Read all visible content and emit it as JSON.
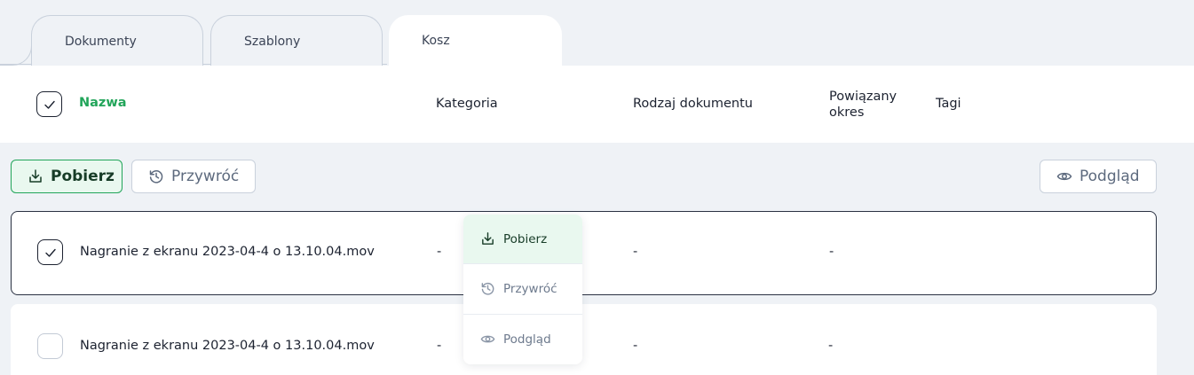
{
  "tabs": [
    {
      "label": "Dokumenty"
    },
    {
      "label": "Szablony"
    },
    {
      "label": "Kosz",
      "active": true
    }
  ],
  "table": {
    "headers": {
      "name": "Nazwa",
      "category": "Kategoria",
      "doc_type": "Rodzaj dokumentu",
      "period": "Powiązany okres",
      "tags": "Tagi"
    },
    "rows": [
      {
        "checked": true,
        "name": "Nagranie z ekranu 2023-04-4 o 13.10.04.mov",
        "category": "-",
        "doc_type": "-",
        "period": "-",
        "tags": ""
      },
      {
        "checked": false,
        "name": "Nagranie z ekranu 2023-04-4 o 13.10.04.mov",
        "category": "-",
        "doc_type": "-",
        "period": "-",
        "tags": ""
      }
    ]
  },
  "toolbar": {
    "download_label": "Pobierz",
    "restore_label": "Przywróć",
    "preview_label": "Podgląd"
  },
  "context_menu": {
    "items": [
      {
        "label": "Pobierz",
        "icon": "download-icon",
        "highlighted": true
      },
      {
        "label": "Przywróć",
        "icon": "restore-icon"
      },
      {
        "label": "Podgląd",
        "icon": "eye-icon"
      }
    ]
  },
  "colors": {
    "accent_green": "#22a55a",
    "background": "#eff2f6",
    "text_dark": "#1c2230"
  }
}
